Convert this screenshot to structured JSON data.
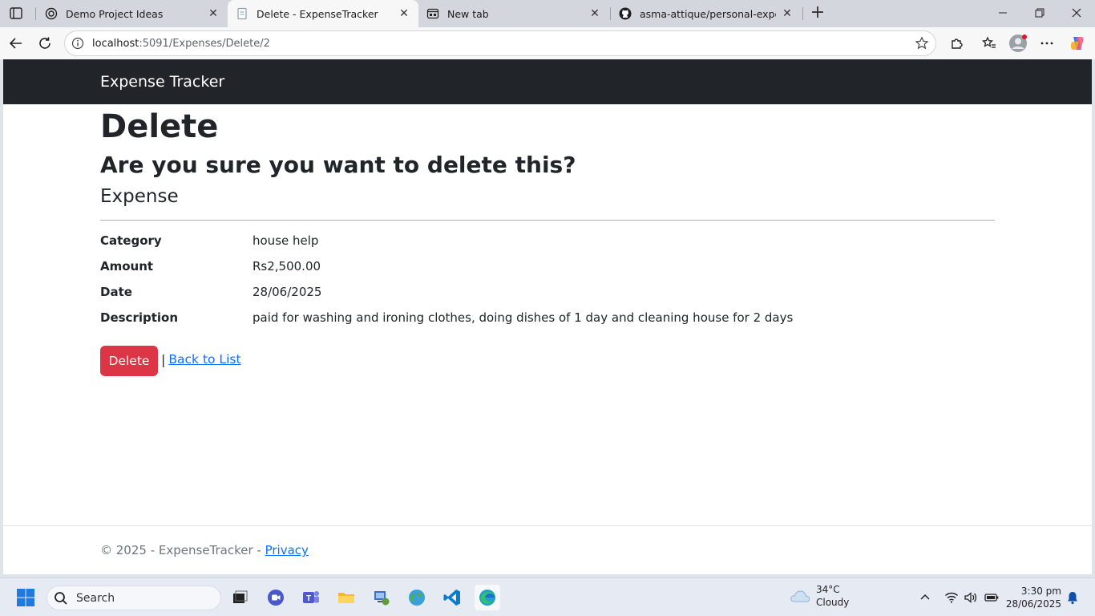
{
  "browser": {
    "tabs": [
      {
        "title": "Demo Project Ideas",
        "favicon": "openai-icon",
        "active": false
      },
      {
        "title": "Delete - ExpenseTracker",
        "favicon": "page-icon",
        "active": true
      },
      {
        "title": "New tab",
        "favicon": "newtab-icon",
        "active": false
      },
      {
        "title": "asma-attique/personal-expense-t",
        "favicon": "github-icon",
        "active": false
      }
    ],
    "url": {
      "host": "localhost",
      "path": ":5091/Expenses/Delete/2"
    }
  },
  "app": {
    "brand": "Expense Tracker",
    "page_title": "Delete",
    "confirm": "Are you sure you want to delete this?",
    "entity": "Expense",
    "details": [
      {
        "label": "Category",
        "value": "house help"
      },
      {
        "label": "Amount",
        "value": "Rs2,500.00"
      },
      {
        "label": "Date",
        "value": "28/06/2025"
      },
      {
        "label": "Description",
        "value": "paid for washing and ironing clothes, doing dishes of 1 day and cleaning house for 2 days"
      }
    ],
    "delete_button": "Delete",
    "separator": "|",
    "back_link": "Back to List",
    "footer": {
      "text": "© 2025 - ExpenseTracker - ",
      "privacy": "Privacy"
    },
    "colors": {
      "navbar": "#212529",
      "danger": "#dc3545",
      "link": "#0d6efd"
    }
  },
  "taskbar": {
    "search_label": "Search",
    "weather": {
      "temp": "34°C",
      "condition": "Cloudy"
    },
    "clock": {
      "time": "3:30 pm",
      "date": "28/06/2025"
    }
  }
}
